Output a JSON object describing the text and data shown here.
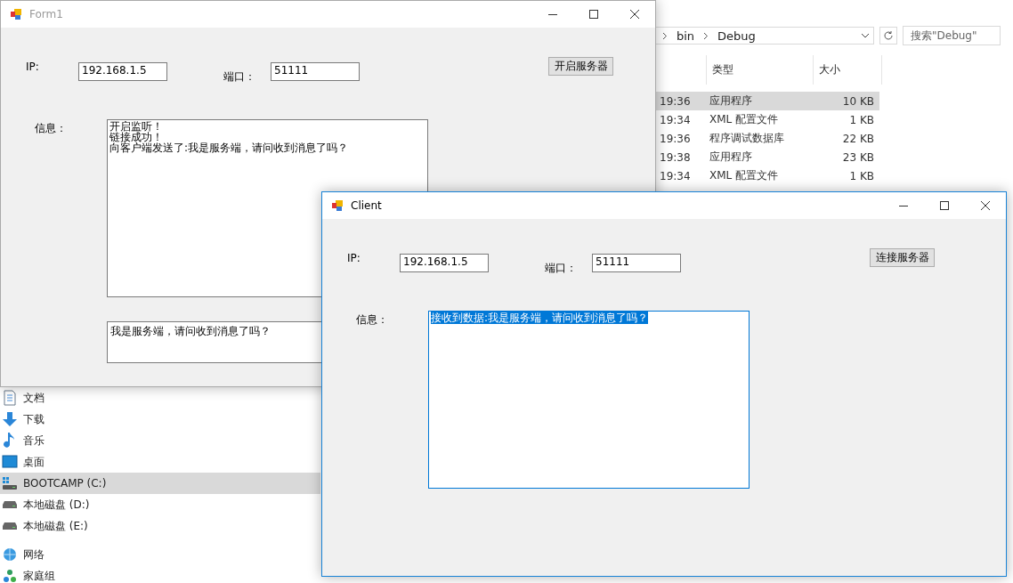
{
  "explorer": {
    "breadcrumb": [
      "bin",
      "Debug"
    ],
    "search": {
      "placeholder": "搜索\"Debug\""
    },
    "columns": [
      "类型",
      "大小"
    ],
    "rows": [
      {
        "time": "19:36",
        "type": "应用程序",
        "size": "10 KB",
        "selected": true
      },
      {
        "time": "19:34",
        "type": "XML 配置文件",
        "size": "1 KB",
        "selected": false
      },
      {
        "time": "19:36",
        "type": "程序调试数据库",
        "size": "22 KB",
        "selected": false
      },
      {
        "time": "19:38",
        "type": "应用程序",
        "size": "23 KB",
        "selected": false
      },
      {
        "time": "19:34",
        "type": "XML 配置文件",
        "size": "1 KB",
        "selected": false
      }
    ],
    "nav": [
      {
        "label": "文档",
        "kind": "document",
        "selected": false
      },
      {
        "label": "下载",
        "kind": "download",
        "selected": false
      },
      {
        "label": "音乐",
        "kind": "music",
        "selected": false
      },
      {
        "label": "桌面",
        "kind": "desktop",
        "selected": false
      },
      {
        "label": "BOOTCAMP (C:)",
        "kind": "system",
        "selected": true
      },
      {
        "label": "本地磁盘 (D:)",
        "kind": "drive",
        "selected": false
      },
      {
        "label": "本地磁盘 (E:)",
        "kind": "drive",
        "selected": false
      },
      {
        "label": "网络",
        "kind": "network",
        "selected": false
      },
      {
        "label": "家庭组",
        "kind": "homegroup",
        "selected": false
      }
    ]
  },
  "windows": [
    {
      "title": "Form1",
      "active": false,
      "ip_label": "IP:",
      "ip": "192.168.1.5",
      "port_label": "端口：",
      "port": "51111",
      "button": "开启服务器",
      "info_label": "信息：",
      "log": [
        "开启监听！",
        "链接成功！",
        "向客户端发送了:我是服务端，请问收到消息了吗？"
      ],
      "log_selected": false,
      "message": "我是服务端，请问收到消息了吗？"
    },
    {
      "title": "Client",
      "active": true,
      "ip_label": "IP:",
      "ip": "192.168.1.5",
      "port_label": "端口：",
      "port": "51111",
      "button": "连接服务器",
      "info_label": "信息：",
      "log": [
        "接收到数据:我是服务端，请问收到消息了吗？"
      ],
      "log_selected": true
    }
  ]
}
